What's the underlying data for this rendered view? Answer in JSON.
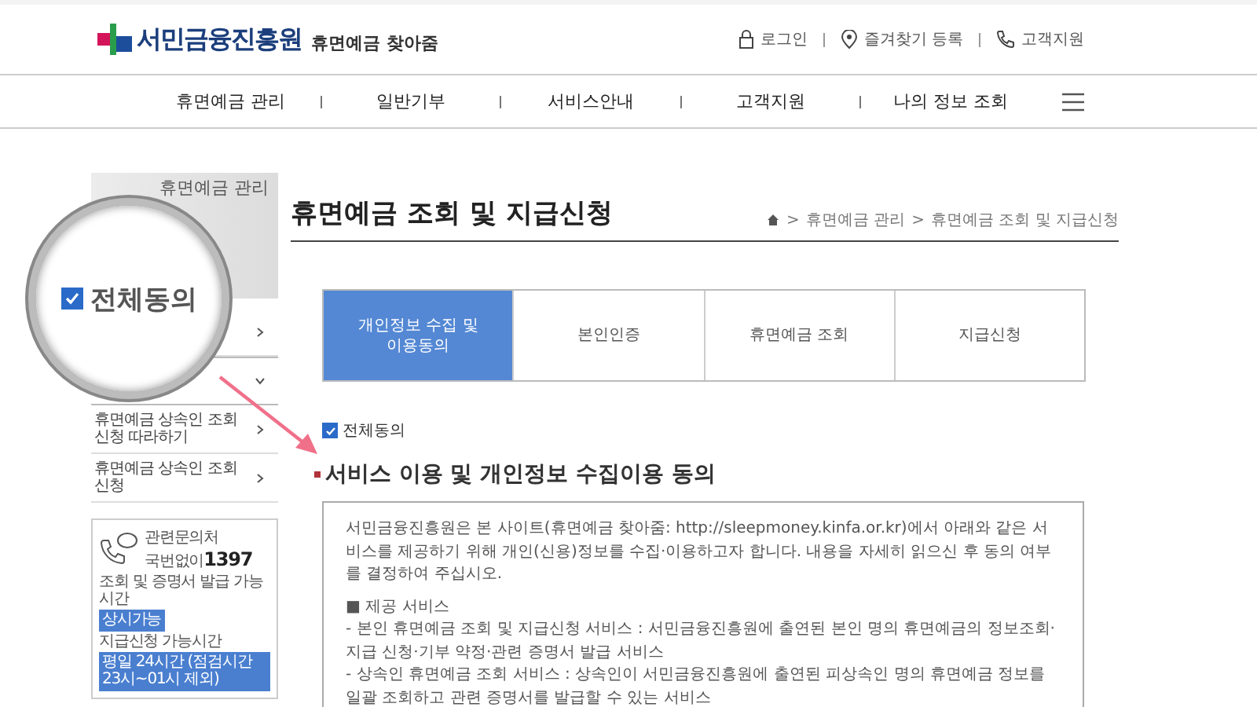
{
  "header": {
    "logo": "서민금융진흥원",
    "service_name": "휴면예금 찾아줌",
    "utility_links": [
      {
        "label": "로그인",
        "kind": "lock"
      },
      {
        "label": "즐겨찾기 등록",
        "kind": "pin"
      },
      {
        "label": "고객지원",
        "kind": "phone"
      }
    ]
  },
  "nav": {
    "items": [
      "휴면예금 관리",
      "일반기부",
      "서비스안내",
      "고객지원",
      "나의 정보 조회"
    ]
  },
  "sidebar": {
    "title": "휴면예금 관리",
    "items": [
      {
        "expanded": false
      },
      {
        "expanded": true
      },
      {
        "label": "휴면예금 상속인 조회신청 따라하기",
        "expanded": false
      },
      {
        "label": "휴면예금 상속인 조회신청",
        "expanded": false
      }
    ],
    "contact": {
      "label": "관련문의처",
      "number_prefix": "국번없이",
      "number": "1397",
      "hours": [
        {
          "label": "조회 및 증명서 발급 가능시간",
          "badge": "상시가능"
        },
        {
          "label": "지급신청 가능시간",
          "badge": "평일 24시간 (점검시간 23시~01시 제외)"
        }
      ]
    }
  },
  "page": {
    "title": "휴면예금 조회 및 지급신청",
    "breadcrumb": {
      "separator": ">",
      "items": [
        "휴면예금 관리",
        "휴면예금 조회 및 지급신청"
      ]
    },
    "steps": [
      {
        "label": "개인정보 수집 및 이용동의",
        "selected": true
      },
      {
        "label": "본인인증",
        "selected": false
      },
      {
        "label": "휴면예금 조회",
        "selected": false
      },
      {
        "label": "지급신청",
        "selected": false
      }
    ],
    "agree_all": {
      "label": "전체동의",
      "checked": true
    },
    "section_title": "서비스 이용 및 개인정보 수집이용 동의",
    "terms": [
      "서민금융진흥원은 본 사이트(휴면예금 찾아줌: http://sleepmoney.kinfa.or.kr)에서 아래와 같은 서비스를 제공하기 위해 개인(신용)정보를 수집·이용하고자 합니다. 내용을 자세히 읽으신 후 동의 여부를 결정하여 주십시오.",
      "■ 제공 서비스",
      "- 본인 휴면예금 조회 및 지급신청 서비스 : 서민금융진흥원에 출연된 본인 명의 휴면예금의 정보조회·지급 신청·기부 약정·관련 증명서 발급 서비스",
      "- 상속인 휴면예금 조회 서비스 : 상속인이 서민금융진흥원에 출연된 피상속인 명의 휴면예금 정보를 일괄 조회하고 관련 증명서를 발급할 수 있는 서비스"
    ]
  },
  "magnifier": {
    "label": "전체동의",
    "checked": true
  }
}
